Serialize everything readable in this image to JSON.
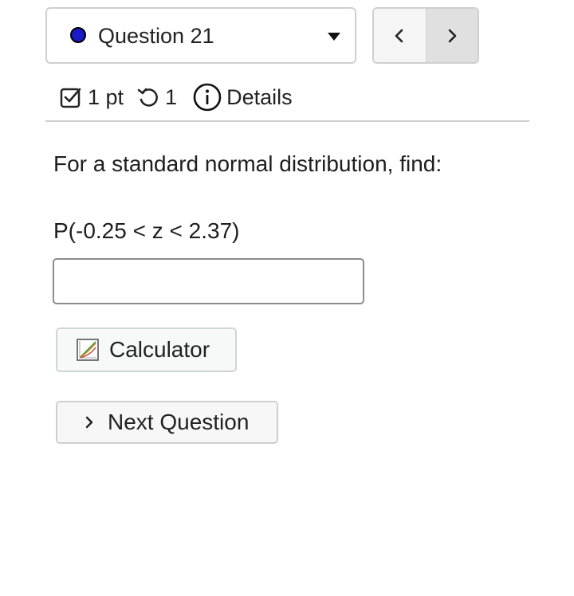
{
  "question_selector": {
    "label": "Question 21",
    "status_color": "#1a1ac8",
    "caret_icon": "caret-down-icon"
  },
  "nav": {
    "prev_icon": "chevron-left-icon",
    "next_icon": "chevron-right-icon"
  },
  "meta": {
    "points": "1 pt",
    "attempts": "1",
    "details": "Details",
    "points_icon": "checkbox-icon",
    "attempts_icon": "retry-icon",
    "details_icon": "info-icon"
  },
  "question": {
    "prompt": "For a standard normal distribution, find:",
    "expression": "P(-0.25 < z < 2.37)",
    "answer_value": ""
  },
  "buttons": {
    "calculator_label": "Calculator",
    "calculator_icon": "graph-calculator-icon",
    "next_question_label": "Next Question",
    "next_question_icon": "chevron-right-icon"
  }
}
